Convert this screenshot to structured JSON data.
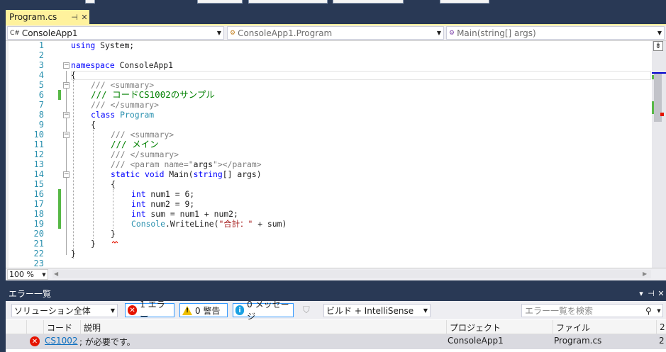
{
  "tab": {
    "title": "Program.cs",
    "pin_glyph": "⊣",
    "close_glyph": "✕"
  },
  "navbar": {
    "project": "ConsoleApp1",
    "project_icon": "C#",
    "class": "ConsoleApp1.Program",
    "member": "Main(string[] args)"
  },
  "line_numbers": [
    "1",
    "2",
    "3",
    "4",
    "5",
    "6",
    "7",
    "8",
    "9",
    "10",
    "11",
    "12",
    "13",
    "14",
    "15",
    "16",
    "17",
    "18",
    "19",
    "20",
    "21",
    "22",
    "23"
  ],
  "code": {
    "l1_kw": "using",
    "l1_rest": " System;",
    "l3_kw": "namespace",
    "l3_rest": " ConsoleApp1",
    "l4": "{",
    "l5_a": "/// ",
    "l5_b": "<summary>",
    "l6": "/// コードCS1002のサンプル",
    "l7_a": "/// ",
    "l7_b": "</summary>",
    "l8_kw": "class",
    "l8_ty": " Program",
    "l9": "{",
    "l10_a": "/// ",
    "l10_b": "<summary>",
    "l11": "/// メイン",
    "l12_a": "/// ",
    "l12_b": "</summary>",
    "l13_a": "/// ",
    "l13_b": "<param name=\"",
    "l13_c": "args",
    "l13_d": "\"></param>",
    "l14_a": "static",
    "l14_b": " void",
    "l14_c": " Main(",
    "l14_d": "string",
    "l14_e": "[] args)",
    "l15": "{",
    "l16_kw": "int",
    "l16_rest": " num1 = 6;",
    "l17_kw": "int",
    "l17_rest": " num2 = 9;",
    "l18_kw": "int",
    "l18_rest": " sum = num1 + num2;",
    "l19_ty": "Console",
    "l19_a": ".WriteLine(",
    "l19_st": "\"合計：\"",
    "l19_b": " + sum)",
    "l20": "}",
    "l21": "}",
    "l22": "}"
  },
  "zoom": "100 %",
  "error_list": {
    "title": "エラー一覧",
    "scope": "ソリューション全体",
    "errors_btn": "1 エラー",
    "warnings_btn": "0 警告",
    "messages_btn": "0 メッセージ",
    "build_filter": "ビルド + IntelliSense",
    "search_placeholder": "エラー一覧を検索",
    "columns": {
      "code": "コード",
      "desc": "説明",
      "project": "プロジェクト",
      "file": "ファイル",
      "line": "2"
    },
    "row": {
      "code": "CS1002",
      "desc": "; が必要です。",
      "project": "ConsoleApp1",
      "file": "Program.cs",
      "line": "2"
    }
  },
  "colors": {
    "accent_tab": "#fff29d",
    "chrome": "#293955",
    "error": "#e51400",
    "change_marker": "#57b846"
  }
}
